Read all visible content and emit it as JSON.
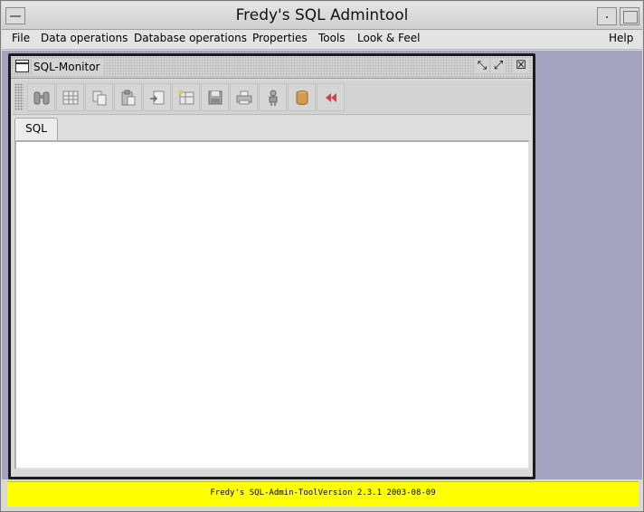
{
  "window": {
    "title": "Fredy's SQL Admintool"
  },
  "menubar": {
    "items": [
      "File",
      "Data operations",
      "Database operations",
      "Properties",
      "Tools",
      "Look & Feel"
    ],
    "help": "Help"
  },
  "internal_frame": {
    "title": "SQL-Monitor",
    "buttons": {
      "minimize": "⤡",
      "maximize": "⤢",
      "close": "☒"
    }
  },
  "toolbar": {
    "icons": [
      "binoculars-icon",
      "table-icon",
      "copy-icon",
      "paste-icon",
      "import-icon",
      "new-table-icon",
      "save-icon",
      "print-icon",
      "user-icon",
      "database-icon",
      "back-arrows-icon"
    ]
  },
  "tabs": [
    "SQL"
  ],
  "status": {
    "text": "Fredy's SQL-Admin-ToolVersion 2.3.1  2003-08-09",
    "color": "#ffff00"
  },
  "colors": {
    "desktop": "#a5a3c0",
    "status_bar": "#ffff00",
    "back_arrows": "#cc4444"
  }
}
